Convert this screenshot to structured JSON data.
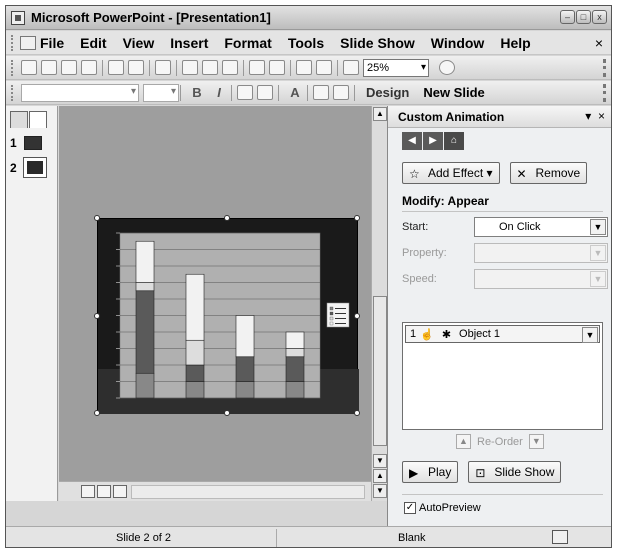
{
  "window": {
    "title": "Microsoft PowerPoint - [Presentation1]"
  },
  "menu": {
    "items": [
      "File",
      "Edit",
      "View",
      "Insert",
      "Format",
      "Tools",
      "Slide Show",
      "Window",
      "Help"
    ],
    "close_glyph": "×"
  },
  "toolbar": {
    "zoom": "25%",
    "bold": "B",
    "italic": "I",
    "font_grow": "A",
    "design_label": "Design",
    "new_slide_label": "New Slide"
  },
  "outline": {
    "slides": [
      {
        "number": "1"
      },
      {
        "number": "2"
      }
    ]
  },
  "chart_data": {
    "type": "bar",
    "stacked": true,
    "categories": [
      "",
      "",
      "",
      ""
    ],
    "series": [
      {
        "values": [
          3,
          2,
          2,
          2
        ]
      },
      {
        "values": [
          10,
          2,
          3,
          3
        ]
      },
      {
        "values": [
          1,
          3,
          0,
          1
        ]
      },
      {
        "values": [
          5,
          8,
          5,
          2
        ]
      }
    ],
    "ylim": [
      0,
      20
    ],
    "grid": true,
    "legend": "right",
    "colors": [
      "#888888",
      "#5a5a5a",
      "#dddddd",
      "#f2f2f2"
    ]
  },
  "task_pane": {
    "title": "Custom Animation",
    "add_effect_label": "Add Effect ▾",
    "remove_label": "Remove",
    "modify_label": "Modify: Appear",
    "start_label": "Start:",
    "start_value": "On Click",
    "property_label": "Property:",
    "speed_label": "Speed:",
    "animation_items": [
      {
        "order": "1",
        "name": "Object 1"
      }
    ],
    "reorder_label": "Re-Order",
    "play_label": "Play",
    "slide_show_label": "Slide Show",
    "autopreview_label": "AutoPreview",
    "autopreview_checked": true
  },
  "status": {
    "slide_position": "Slide 2 of 2",
    "design_name": "Blank"
  },
  "colors": {
    "slide_bg": "#1a1a1a",
    "workspace": "#9e9e9e"
  }
}
